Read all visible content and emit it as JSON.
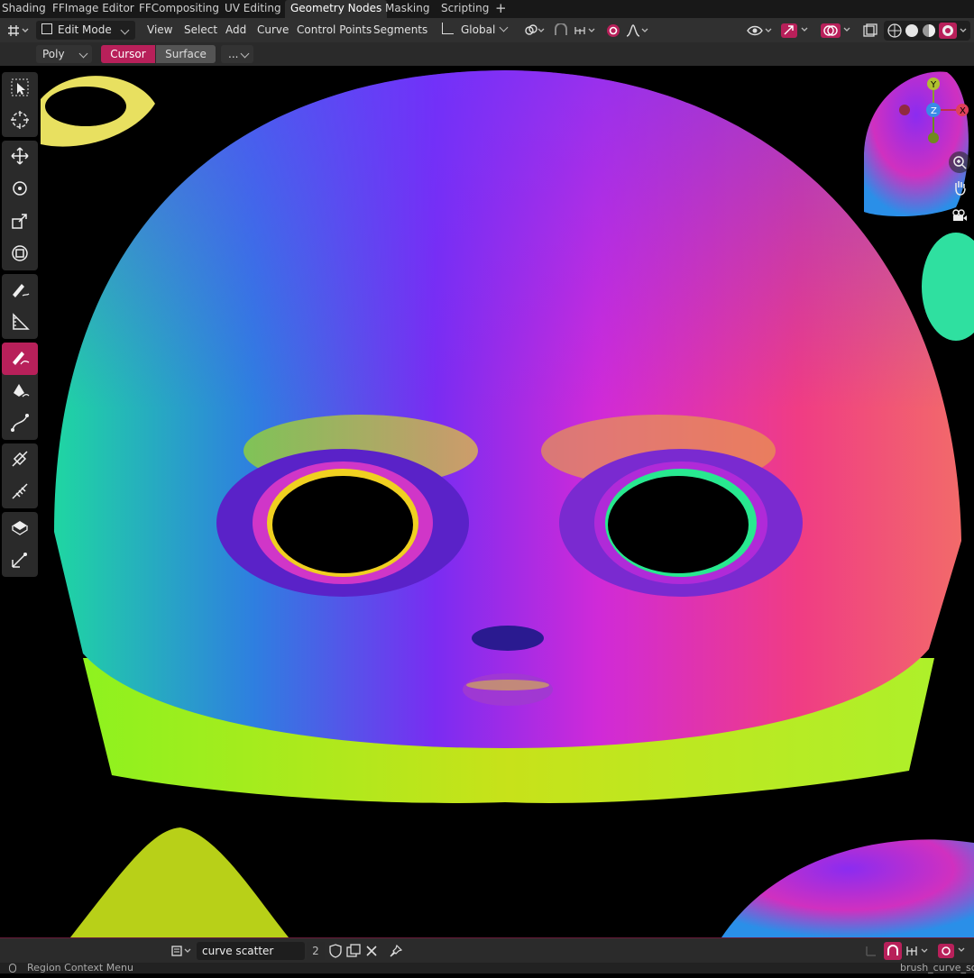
{
  "workspace_tabs": [
    "Shading",
    "FFImage Editor",
    "FFCompositing",
    "UV Editing",
    "Geometry Nodes",
    "Masking",
    "Scripting"
  ],
  "active_tab": "Geometry Nodes",
  "add_tab_glyph": "+",
  "header": {
    "mode": "Edit Mode",
    "menus": [
      "View",
      "Select",
      "Add",
      "Curve",
      "Control Points",
      "Segments"
    ],
    "transform_orientation": "Global"
  },
  "tool_settings": {
    "curve_type": "Poly",
    "surface_options": [
      "Cursor",
      "Surface"
    ],
    "active_option": "Cursor",
    "more": "..."
  },
  "bottom": {
    "brush_name": "curve scatter brush",
    "users_count": "2"
  },
  "status": {
    "left": "Region Context Menu",
    "right": "brush_curve_sca"
  },
  "colors": {
    "accent": "#b8205a",
    "header_bg": "#303030",
    "tabs_bg": "#181818"
  },
  "icons": [
    "select-cursor-icon",
    "cursor-icon",
    "move-icon",
    "rotate-icon",
    "scale-icon",
    "transform-icon",
    "annotate-icon",
    "measure-icon",
    "draw-icon",
    "pen-icon",
    "curve-edit-icon",
    "tilt-icon",
    "radius-icon",
    "extrude-icon",
    "randomize-icon"
  ]
}
